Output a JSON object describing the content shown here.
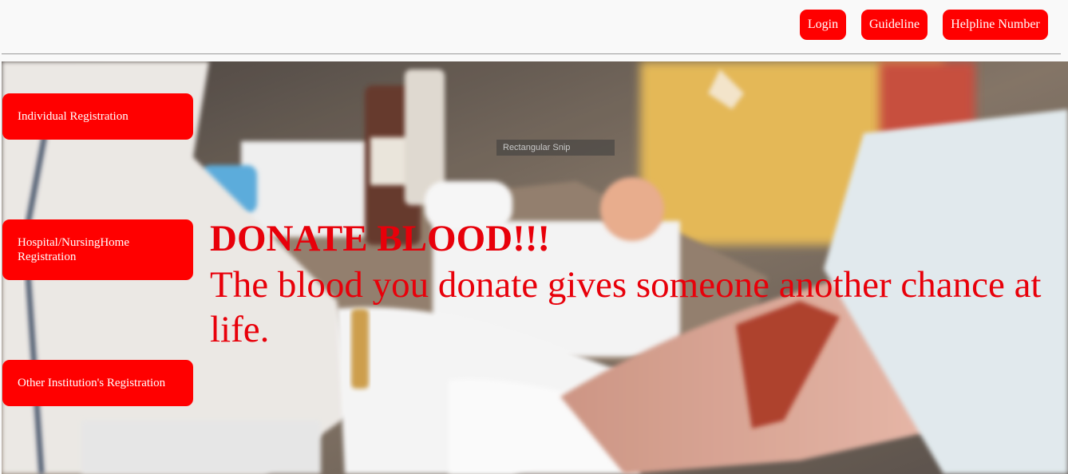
{
  "nav": {
    "login_label": "Login",
    "guideline_label": "Guideline",
    "helpline_label": "Helpline Number"
  },
  "sidebar": {
    "items": [
      {
        "label": "Individual Registration"
      },
      {
        "label": "Hospital/NursingHome Registration"
      },
      {
        "label": "Other Institution's Registration"
      }
    ]
  },
  "hero": {
    "headline": "DONATE BLOOD!!!",
    "tagline": "The blood you donate gives someone another chance at life.",
    "overlay_label": "Rectangular Snip"
  },
  "colors": {
    "accent": "#ff0000",
    "headline_text": "#e8000a",
    "page_bg": "#f9f9f9"
  }
}
